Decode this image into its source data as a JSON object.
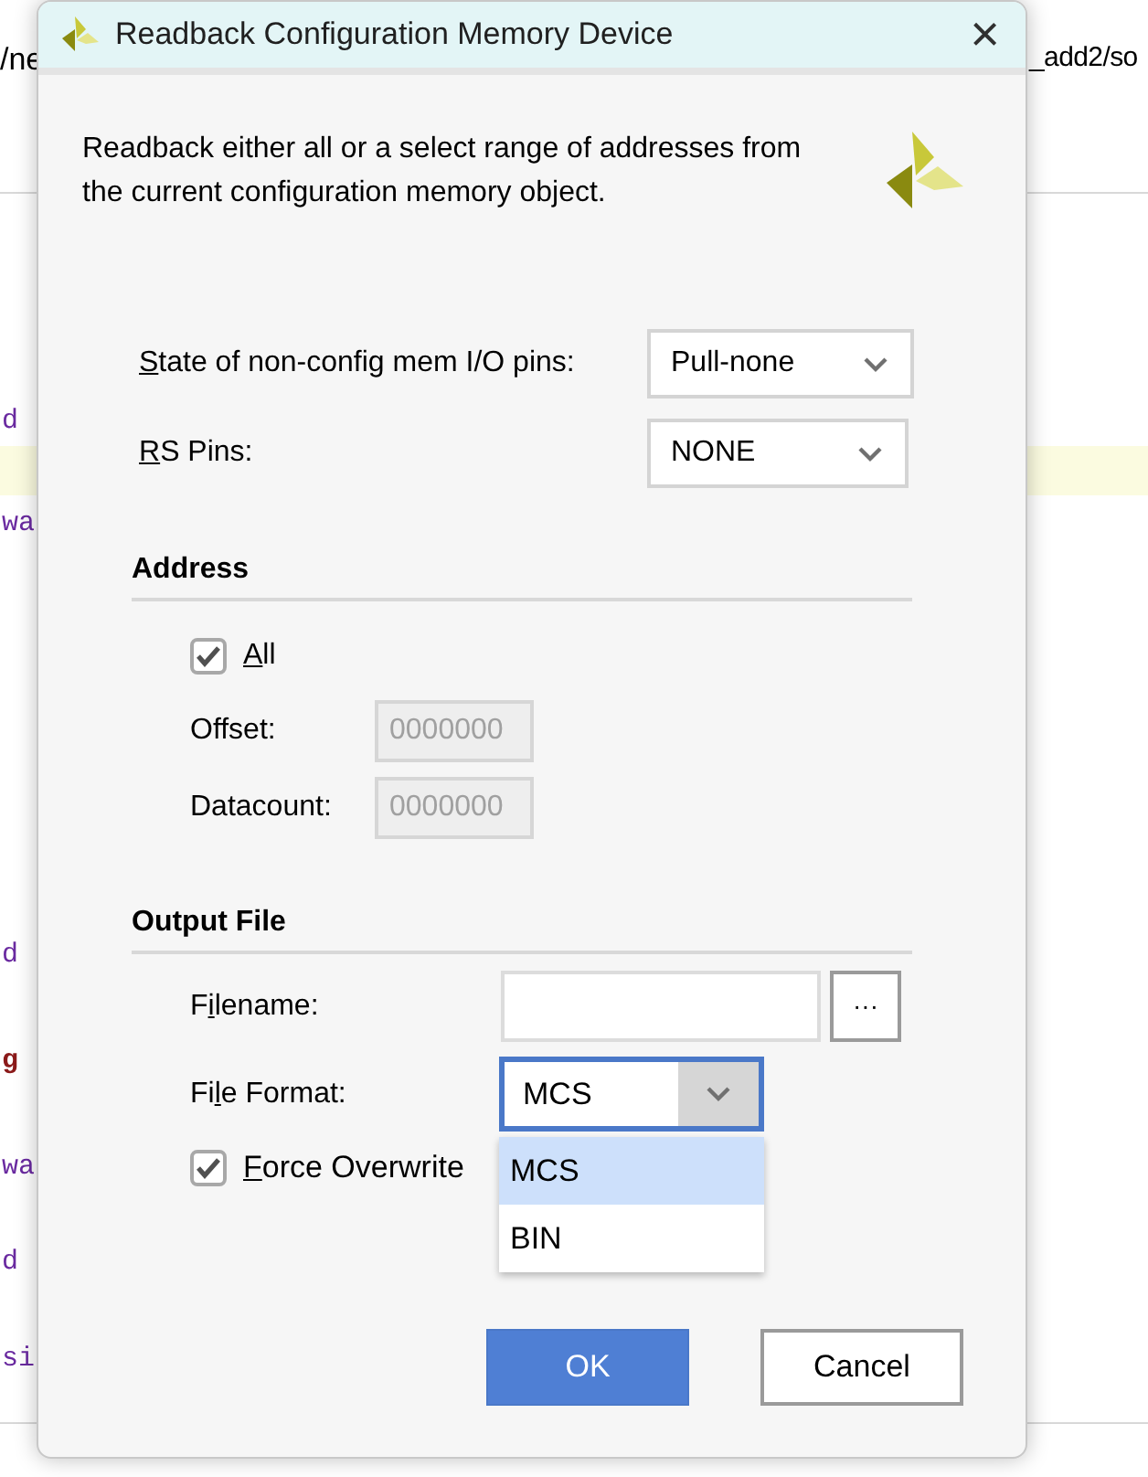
{
  "background": {
    "fragments_left": [
      "d",
      "wa",
      "d",
      "g",
      "wa",
      "d",
      "si"
    ],
    "fragment_top_left": "/ne",
    "fragment_top_right": "_add2/so"
  },
  "window": {
    "title": "Readback Configuration Memory Device",
    "close": "×"
  },
  "description": "Readback either all or a select range of addresses from the current configuration memory object.",
  "pins": [
    {
      "label": {
        "access_key": "S",
        "rest": "tate of non-config mem I/O pins:"
      },
      "value": "Pull-none"
    },
    {
      "label": {
        "access_key": "R",
        "rest": "S Pins:"
      },
      "value": "NONE"
    }
  ],
  "address": {
    "heading": "Address",
    "all": {
      "label": {
        "access_key": "A",
        "rest": "ll"
      },
      "checked": true
    },
    "fields": [
      {
        "label": "Offset:",
        "value": "0000000",
        "disabled": true
      },
      {
        "label": "Datacount:",
        "value": "0000000",
        "disabled": true
      }
    ]
  },
  "output_file": {
    "heading": "Output File",
    "filename": {
      "label": {
        "start": "F",
        "access_key": "i",
        "rest": "lename:"
      },
      "browse": "···"
    },
    "file_format": {
      "label": {
        "start": "Fi",
        "access_key": "l",
        "rest": "e Format:"
      },
      "value": "MCS",
      "expanded": true,
      "options": [
        {
          "label": "MCS",
          "selected": true
        },
        {
          "label": "BIN",
          "selected": false
        }
      ]
    },
    "force_overwrite": {
      "label": {
        "access_key": "F",
        "rest": "orce Overwrite"
      },
      "checked": true
    }
  },
  "buttons": [
    {
      "label": "OK",
      "kind": "primary"
    },
    {
      "label": "Cancel",
      "kind": "secondary"
    }
  ]
}
